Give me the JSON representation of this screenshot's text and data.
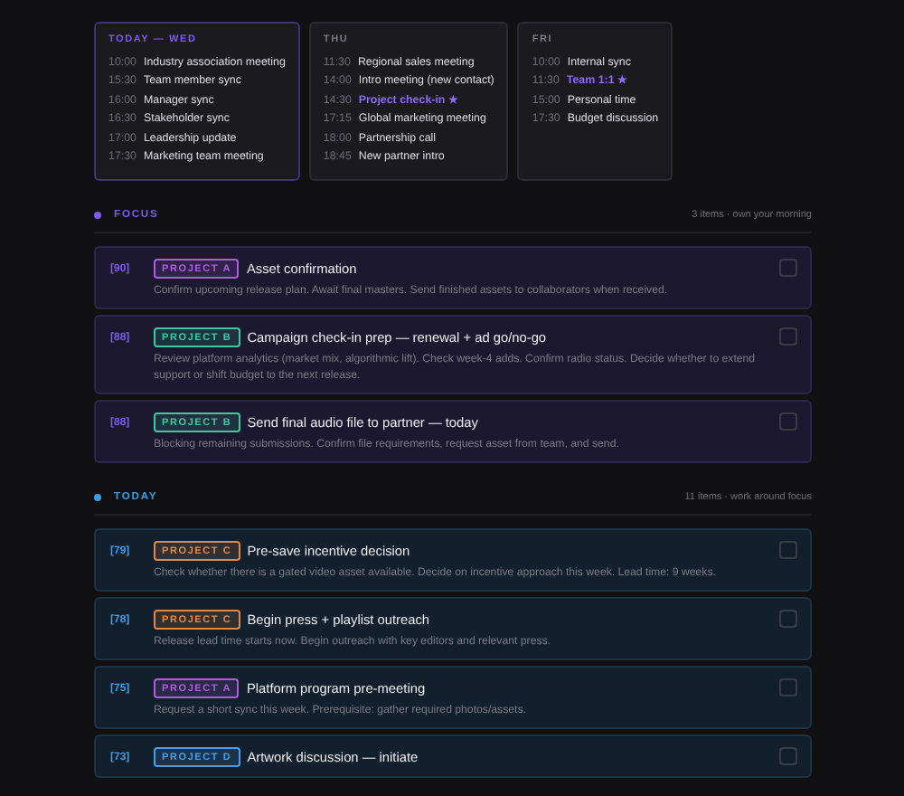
{
  "days": [
    {
      "label": "TODAY — WED",
      "selected": true,
      "events": [
        {
          "time": "10:00",
          "title": "Industry association meeting",
          "highlighted": false
        },
        {
          "time": "15:30",
          "title": "Team member sync",
          "highlighted": false
        },
        {
          "time": "16:00",
          "title": "Manager sync",
          "highlighted": false
        },
        {
          "time": "16:30",
          "title": "Stakeholder sync",
          "highlighted": false
        },
        {
          "time": "17:00",
          "title": "Leadership update",
          "highlighted": false
        },
        {
          "time": "17:30",
          "title": "Marketing team meeting",
          "highlighted": false
        }
      ]
    },
    {
      "label": "THU",
      "selected": false,
      "events": [
        {
          "time": "11:30",
          "title": "Regional sales meeting",
          "highlighted": false
        },
        {
          "time": "14:00",
          "title": "Intro meeting (new contact)",
          "highlighted": false
        },
        {
          "time": "14:30",
          "title": "Project check-in ★",
          "highlighted": true
        },
        {
          "time": "17:15",
          "title": "Global marketing meeting",
          "highlighted": false
        },
        {
          "time": "18:00",
          "title": "Partnership call",
          "highlighted": false
        },
        {
          "time": "18:45",
          "title": "New partner intro",
          "highlighted": false
        }
      ]
    },
    {
      "label": "FRI",
      "selected": false,
      "events": [
        {
          "time": "10:00",
          "title": "Internal sync",
          "highlighted": false
        },
        {
          "time": "11:30",
          "title": "Team 1:1 ★",
          "highlighted": true
        },
        {
          "time": "15:00",
          "title": "Personal time",
          "highlighted": false
        },
        {
          "time": "17:30",
          "title": "Budget discussion",
          "highlighted": false
        }
      ]
    }
  ],
  "sections": [
    {
      "title": "FOCUS",
      "color": "#7c5cf0",
      "summary": "3 items · own your morning",
      "kind": "focus",
      "tasks": [
        {
          "score": "[90]",
          "project": "PROJECT A",
          "color": "#b05ce0",
          "title": "Asset confirmation",
          "description": "Confirm upcoming release plan. Await final masters. Send finished assets to collaborators when received.",
          "checked": false
        },
        {
          "score": "[88]",
          "project": "PROJECT B",
          "color": "#3ec9a0",
          "title": "Campaign check-in prep — renewal + ad go/no-go",
          "description": "Review platform analytics (market mix, algorithmic lift). Check week-4 adds. Confirm radio status. Decide whether to extend support or shift budget to the next release.",
          "checked": false
        },
        {
          "score": "[88]",
          "project": "PROJECT B",
          "color": "#3ec9a0",
          "title": "Send final audio file to partner — today",
          "description": "Blocking remaining submissions. Confirm file requirements, request asset from team, and send.",
          "checked": false
        }
      ]
    },
    {
      "title": "TODAY",
      "color": "#3a9ee8",
      "summary": "11 items · work around focus",
      "kind": "today",
      "tasks": [
        {
          "score": "[79]",
          "project": "PROJECT C",
          "color": "#e08a4a",
          "title": "Pre-save incentive decision",
          "description": "Check whether there is a gated video asset available. Decide on incentive approach this week. Lead time: 9 weeks.",
          "checked": false
        },
        {
          "score": "[78]",
          "project": "PROJECT C",
          "color": "#e08a4a",
          "title": "Begin press + playlist outreach",
          "description": "Release lead time starts now. Begin outreach with key editors and relevant press.",
          "checked": false
        },
        {
          "score": "[75]",
          "project": "PROJECT A",
          "color": "#b05ce0",
          "title": "Platform program pre-meeting",
          "description": "Request a short sync this week. Prerequisite: gather required photos/assets.",
          "checked": false
        },
        {
          "score": "[73]",
          "project": "PROJECT D",
          "color": "#4a9ee8",
          "title": "Artwork discussion — initiate",
          "checked": false
        }
      ]
    }
  ]
}
